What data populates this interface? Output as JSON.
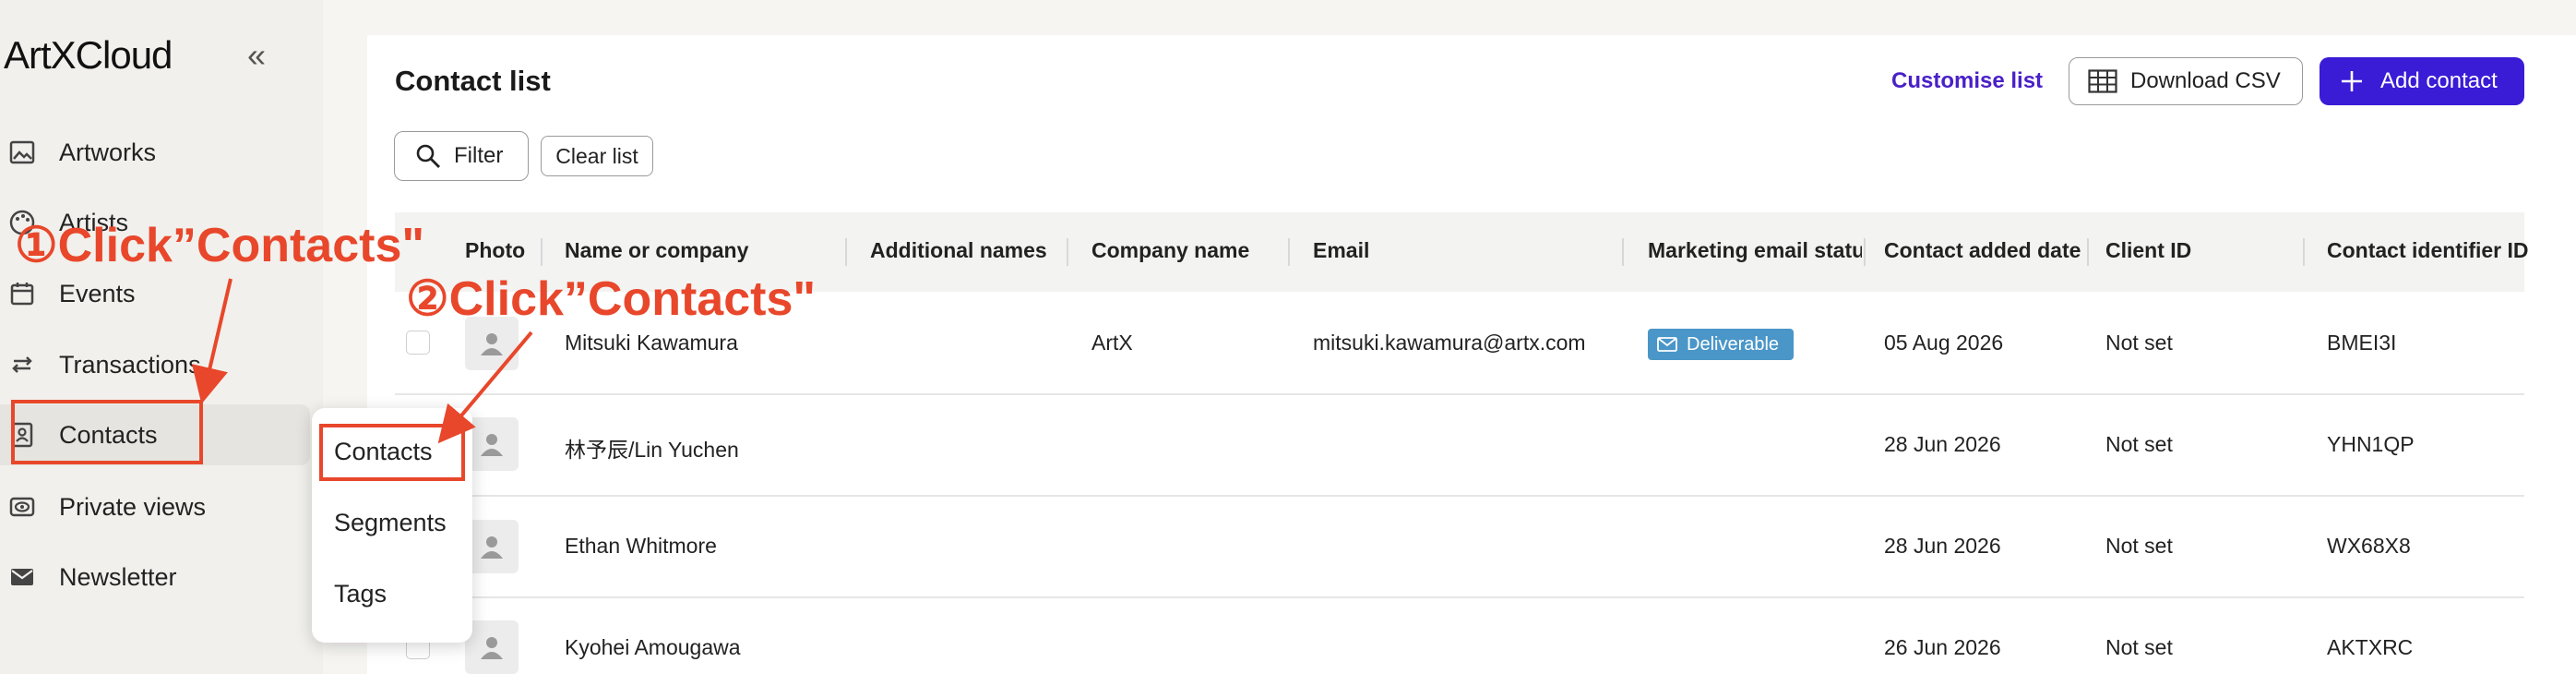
{
  "sidebar": {
    "logo": "ArtXCloud",
    "collapse_icon": "chevrons-left-icon",
    "items": [
      {
        "label": "Artworks",
        "icon": "image-icon"
      },
      {
        "label": "Artists",
        "icon": "palette-icon"
      },
      {
        "label": "Events",
        "icon": "calendar-icon"
      },
      {
        "label": "Transactions",
        "icon": "swap-icon"
      },
      {
        "label": "Contacts",
        "icon": "contact-card-icon"
      },
      {
        "label": "Private views",
        "icon": "eye-icon"
      },
      {
        "label": "Newsletter",
        "icon": "mail-icon"
      }
    ]
  },
  "flyout": {
    "items": [
      "Contacts",
      "Segments",
      "Tags"
    ]
  },
  "header": {
    "title": "Contact list",
    "customise_label": "Customise list",
    "download_label": "Download CSV",
    "add_label": "Add contact"
  },
  "toolbar": {
    "filter_label": "Filter",
    "clear_label": "Clear list"
  },
  "table": {
    "columns": [
      "Photo",
      "Name or company",
      "Additional names",
      "Company name",
      "Email",
      "Marketing email status",
      "Contact added date",
      "Client ID",
      "Contact identifier ID"
    ],
    "rows": [
      {
        "name": "Mitsuki Kawamura",
        "additional": "",
        "company": "ArtX",
        "email": "mitsuki.kawamura@artx.com",
        "marketing": "Deliverable",
        "added": "05 Aug 2026",
        "client_id": "Not set",
        "identifier": "BMEI3I"
      },
      {
        "name": "林予辰/Lin Yuchen",
        "additional": "",
        "company": "",
        "email": "",
        "marketing": "",
        "added": "28 Jun 2026",
        "client_id": "Not set",
        "identifier": "YHN1QP"
      },
      {
        "name": "Ethan Whitmore",
        "additional": "",
        "company": "",
        "email": "",
        "marketing": "",
        "added": "28 Jun 2026",
        "client_id": "Not set",
        "identifier": "WX68X8"
      },
      {
        "name": "Kyohei Amougawa",
        "additional": "",
        "company": "",
        "email": "",
        "marketing": "",
        "added": "26 Jun 2026",
        "client_id": "Not set",
        "identifier": "AKTXRC"
      }
    ]
  },
  "annotations": {
    "step1": "①Click”Contacts\"",
    "step2": "②Click”Contacts\"",
    "color": "#e8472b"
  },
  "colors": {
    "accent": "#3a1bd6",
    "link": "#4a20c8",
    "badge": "#4a96c8"
  }
}
